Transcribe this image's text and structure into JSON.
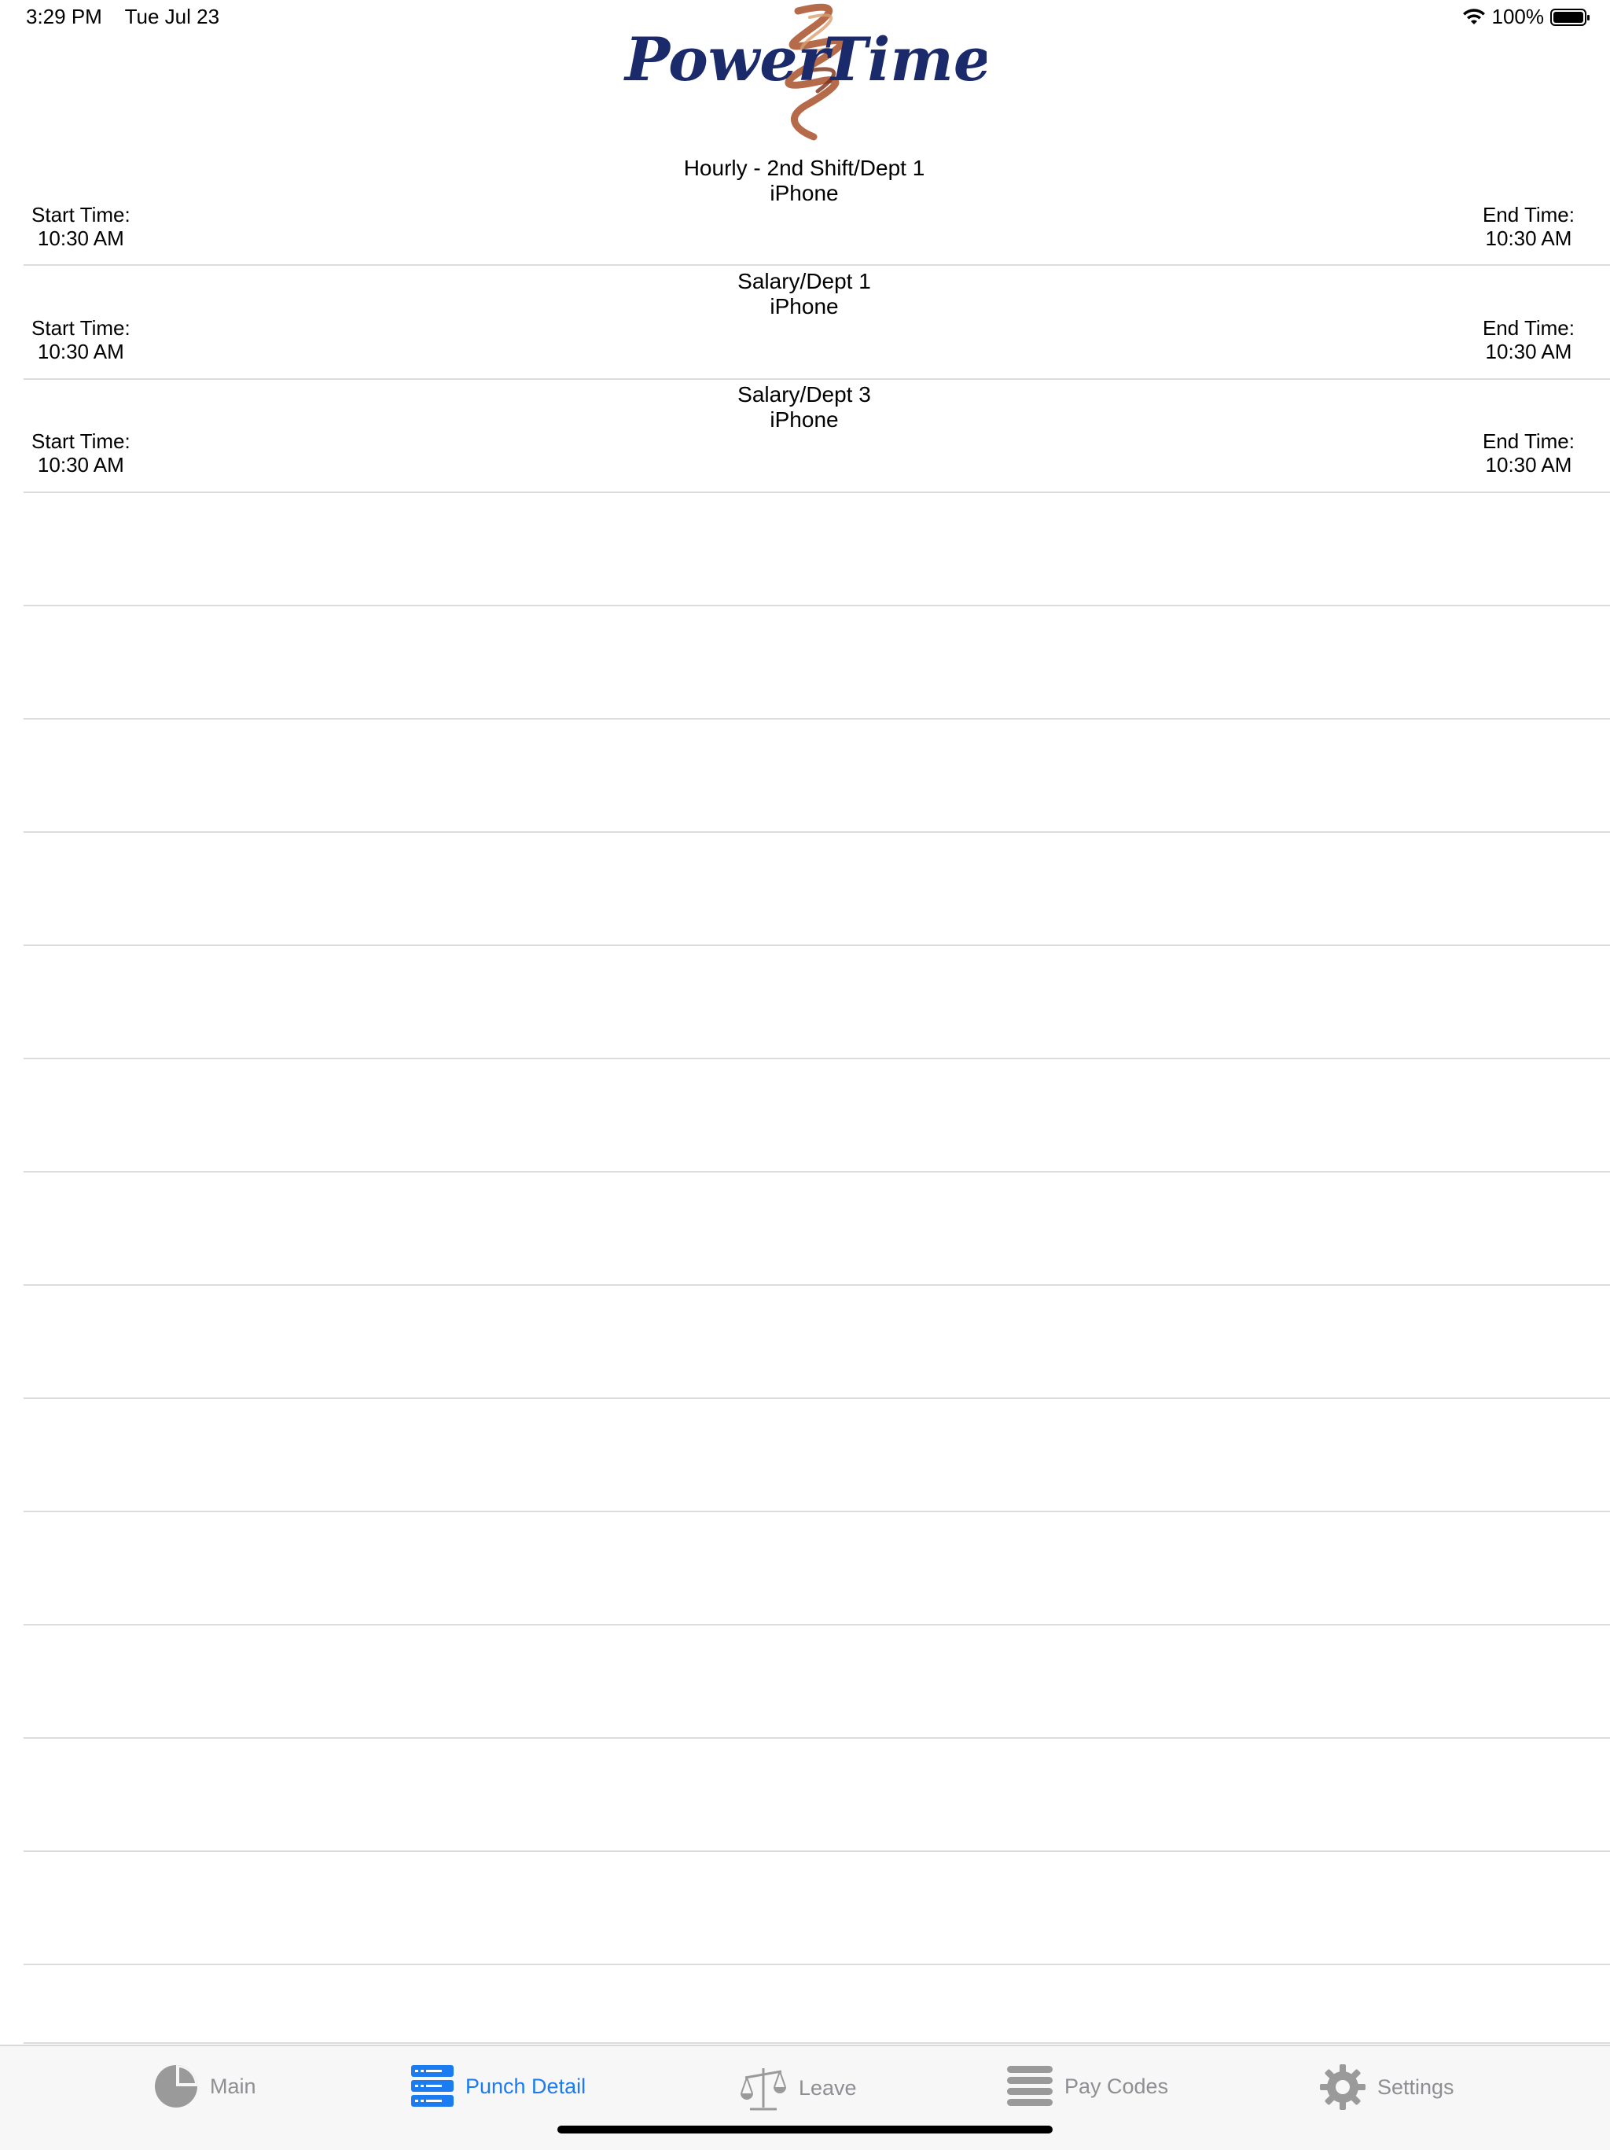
{
  "status": {
    "time": "3:29 PM",
    "date": "Tue Jul 23",
    "battery": "100%"
  },
  "logo": {
    "left_word": "Power",
    "right_word": "Time"
  },
  "entries": [
    {
      "title": "Hourly - 2nd Shift/Dept 1",
      "device": "iPhone",
      "start_label": "Start Time:",
      "start_value": "10:30 AM",
      "end_label": "End Time:",
      "end_value": "10:30 AM"
    },
    {
      "title": "Salary/Dept 1",
      "device": "iPhone",
      "start_label": "Start Time:",
      "start_value": "10:30 AM",
      "end_label": "End Time:",
      "end_value": "10:30 AM"
    },
    {
      "title": "Salary/Dept 3",
      "device": "iPhone",
      "start_label": "Start Time:",
      "start_value": "10:30 AM",
      "end_label": "End Time:",
      "end_value": "10:30 AM"
    }
  ],
  "tabs": [
    {
      "label": "Main",
      "icon": "pie-chart-icon",
      "active": false
    },
    {
      "label": "Punch Detail",
      "icon": "server-list-icon",
      "active": true
    },
    {
      "label": "Leave",
      "icon": "scales-icon",
      "active": false
    },
    {
      "label": "Pay Codes",
      "icon": "list-lines-icon",
      "active": false
    },
    {
      "label": "Settings",
      "icon": "gear-icon",
      "active": false
    }
  ],
  "colors": {
    "accent": "#1a7cf0",
    "inactive": "#8e8e93",
    "logo_text": "#1b2a6b",
    "logo_swoosh": "#a8502a"
  }
}
